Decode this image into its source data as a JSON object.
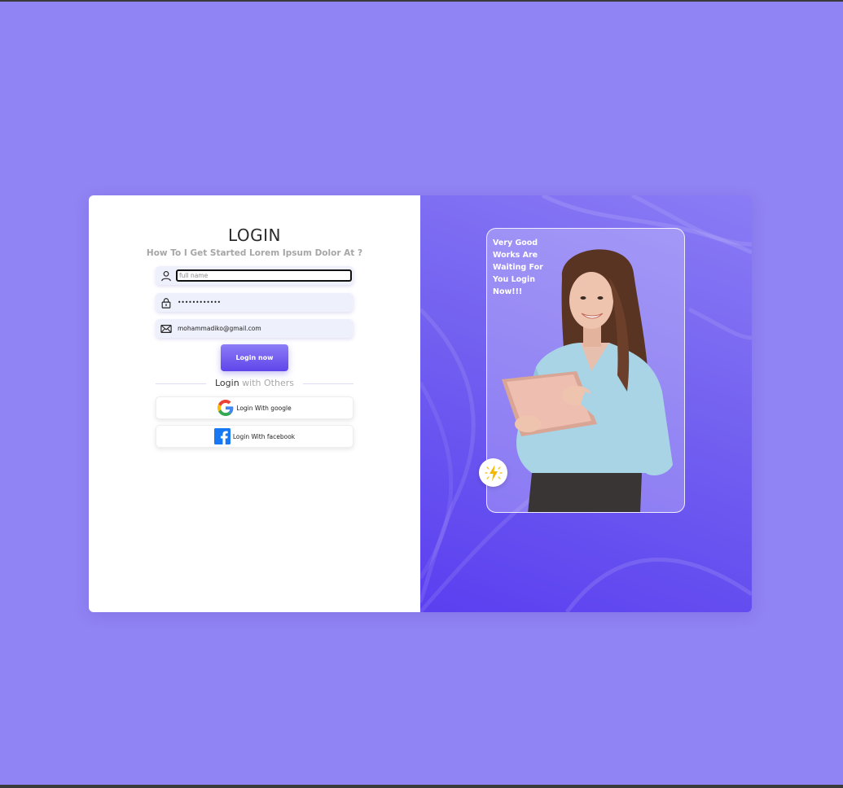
{
  "login": {
    "title": "LOGIN",
    "subtitle": "How To I Get Started Lorem Ipsum Dolor At ?",
    "fullname_placeholder": "full name",
    "password_value": "••••••••••••",
    "email_value": "mohammadiko@gmail.com",
    "button_label": "Login now",
    "divider_primary": "Login",
    "divider_secondary": " with Others",
    "google_label": "Login With google",
    "facebook_label": "Login With facebook"
  },
  "promo": {
    "text": "Very Good Works Are Waiting For You Login Now!!!"
  },
  "colors": {
    "background": "#9083f3",
    "accent": "#6a55ee",
    "google_blue": "#4285F4",
    "google_red": "#EA4335",
    "google_yellow": "#FBBC05",
    "google_green": "#34A853",
    "facebook_blue": "#1877F2",
    "bolt_yellow": "#F5B800"
  },
  "icons": [
    "user-icon",
    "lock-icon",
    "mail-icon",
    "google-icon",
    "facebook-icon",
    "lightning-icon"
  ]
}
